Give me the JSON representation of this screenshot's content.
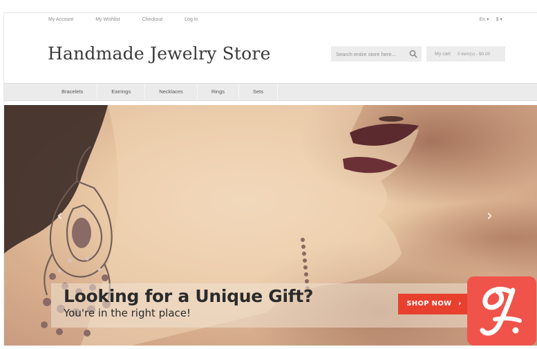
{
  "header": {
    "top_links": [
      "My Account",
      "My Wishlist",
      "Checkout",
      "Log In"
    ],
    "language": "En",
    "currency": "$",
    "logo": "Handmade Jewelry Store",
    "search_placeholder": "Search entire store here...",
    "cart_label": "My cart",
    "cart_summary": "0 item(s) - $0.00"
  },
  "nav": {
    "items": [
      "Bracelets",
      "Earrings",
      "Necklaces",
      "Rings",
      "Sets"
    ]
  },
  "slider": {
    "title": "Looking for a Unique Gift?",
    "subtitle": "You're in the right place!",
    "button": "SHOP NOW",
    "button_arrow": "›",
    "prev_arrow": "‹",
    "next_arrow": "›"
  },
  "colors": {
    "accent": "#e8402f",
    "badge": "#f0534a",
    "navbar": "#ebebeb"
  },
  "icons": {
    "search": "search-icon",
    "badge": "g-logo-badge"
  }
}
